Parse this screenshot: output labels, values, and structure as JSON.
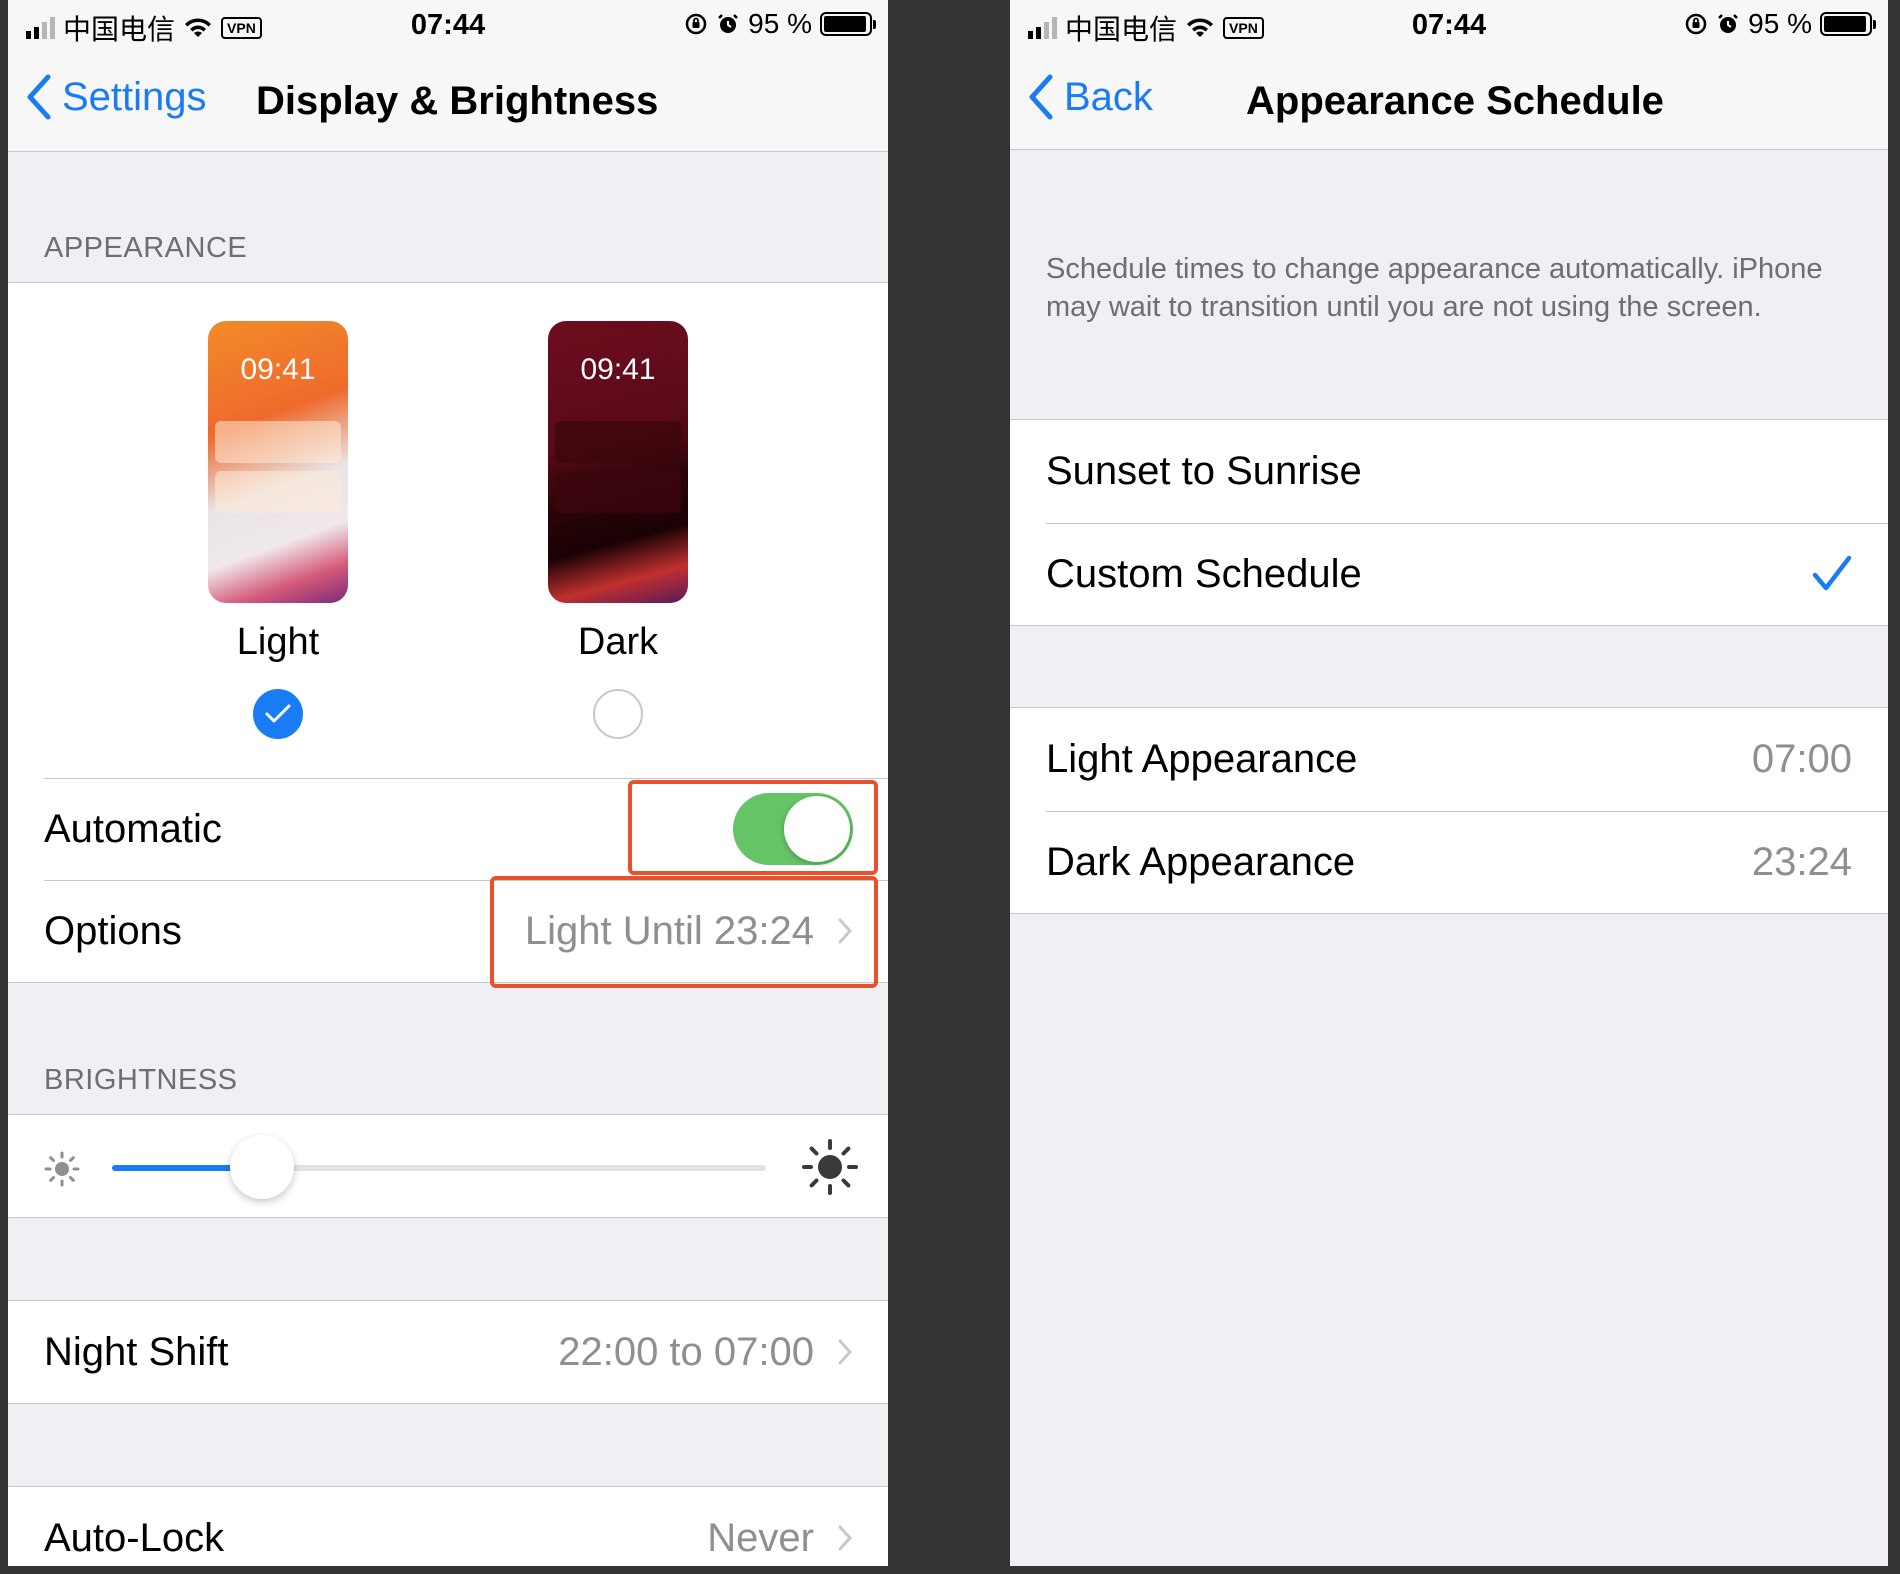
{
  "status_bar": {
    "carrier": "中国电信",
    "vpn": "VPN",
    "time": "07:44",
    "battery": "95 %",
    "battery_level": 0.95
  },
  "left": {
    "nav": {
      "back_label": "Settings",
      "title": "Display & Brightness"
    },
    "appearance": {
      "header": "APPEARANCE",
      "light": {
        "time": "09:41",
        "label": "Light",
        "selected": true
      },
      "dark": {
        "time": "09:41",
        "label": "Dark",
        "selected": false
      },
      "automatic_label": "Automatic",
      "automatic_on": true,
      "options_label": "Options",
      "options_value": "Light Until 23:24"
    },
    "brightness": {
      "header": "BRIGHTNESS",
      "level": 0.23
    },
    "night_shift": {
      "label": "Night Shift",
      "value": "22:00 to 07:00"
    },
    "auto_lock": {
      "label": "Auto-Lock",
      "value": "Never"
    }
  },
  "right": {
    "nav": {
      "back_label": "Back",
      "title": "Appearance Schedule"
    },
    "description": "Schedule times to change appearance automatically. iPhone may wait to transition until you are not using the screen.",
    "schedule": {
      "sunset_label": "Sunset to Sunrise",
      "custom_label": "Custom Schedule",
      "selected": "custom"
    },
    "times": {
      "light_label": "Light Appearance",
      "light_value": "07:00",
      "dark_label": "Dark Appearance",
      "dark_value": "23:24"
    }
  },
  "colors": {
    "accent": "#1a7cf5",
    "toggle_on": "#65c466",
    "highlight": "#e8512b"
  }
}
